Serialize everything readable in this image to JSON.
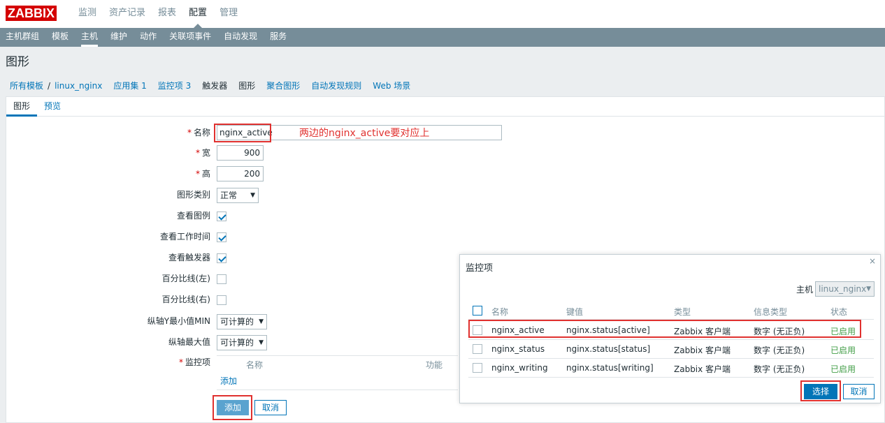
{
  "logo": "ZABBIX",
  "top_menu": [
    "监测",
    "资产记录",
    "报表",
    "配置",
    "管理"
  ],
  "top_menu_active": "配置",
  "sub_menu": [
    "主机群组",
    "模板",
    "主机",
    "维护",
    "动作",
    "关联项事件",
    "自动发现",
    "服务"
  ],
  "sub_menu_active": "主机",
  "page_title": "图形",
  "breadcrumbs": {
    "all_templates": "所有模板",
    "sep": "/",
    "items": [
      "linux_nginx",
      "应用集 1",
      "监控项 3",
      "触发器",
      "图形",
      "聚合图形",
      "自动发现规则",
      "Web 场景"
    ]
  },
  "tabs": [
    "图形",
    "预览"
  ],
  "form": {
    "name_label": "名称",
    "name_value": "nginx_active",
    "width_label": "宽",
    "width_value": "900",
    "height_label": "高",
    "height_value": "200",
    "graph_type_label": "图形类别",
    "graph_type_value": "正常",
    "show_legend_label": "查看图例",
    "show_working_time_label": "查看工作时间",
    "show_triggers_label": "查看触发器",
    "percentile_left_label": "百分比线(左)",
    "percentile_right_label": "百分比线(右)",
    "ymin_label": "纵轴Y最小值MIN",
    "ymin_value": "可计算的",
    "ymax_label": "纵轴最大值",
    "ymax_value": "可计算的",
    "items_label": "监控项",
    "items_col_name": "名称",
    "items_col_func": "功能",
    "items_add_link": "添加",
    "add_button": "添加",
    "cancel_button": "取消"
  },
  "annotation": "两边的nginx_active要对应上",
  "dialog": {
    "title": "监控项",
    "close": "×",
    "host_label": "主机",
    "host_value": "linux_nginx",
    "columns": [
      "名称",
      "键值",
      "类型",
      "信息类型",
      "状态"
    ],
    "rows": [
      {
        "name": "nginx_active",
        "key": "nginx.status[active]",
        "type": "Zabbix 客户端",
        "info": "数字 (无正负)",
        "status": "已启用"
      },
      {
        "name": "nginx_status",
        "key": "nginx.status[status]",
        "type": "Zabbix 客户端",
        "info": "数字 (无正负)",
        "status": "已启用"
      },
      {
        "name": "nginx_writing",
        "key": "nginx.status[writing]",
        "type": "Zabbix 客户端",
        "info": "数字 (无正负)",
        "status": "已启用"
      }
    ],
    "select_button": "选择",
    "cancel_button": "取消"
  }
}
